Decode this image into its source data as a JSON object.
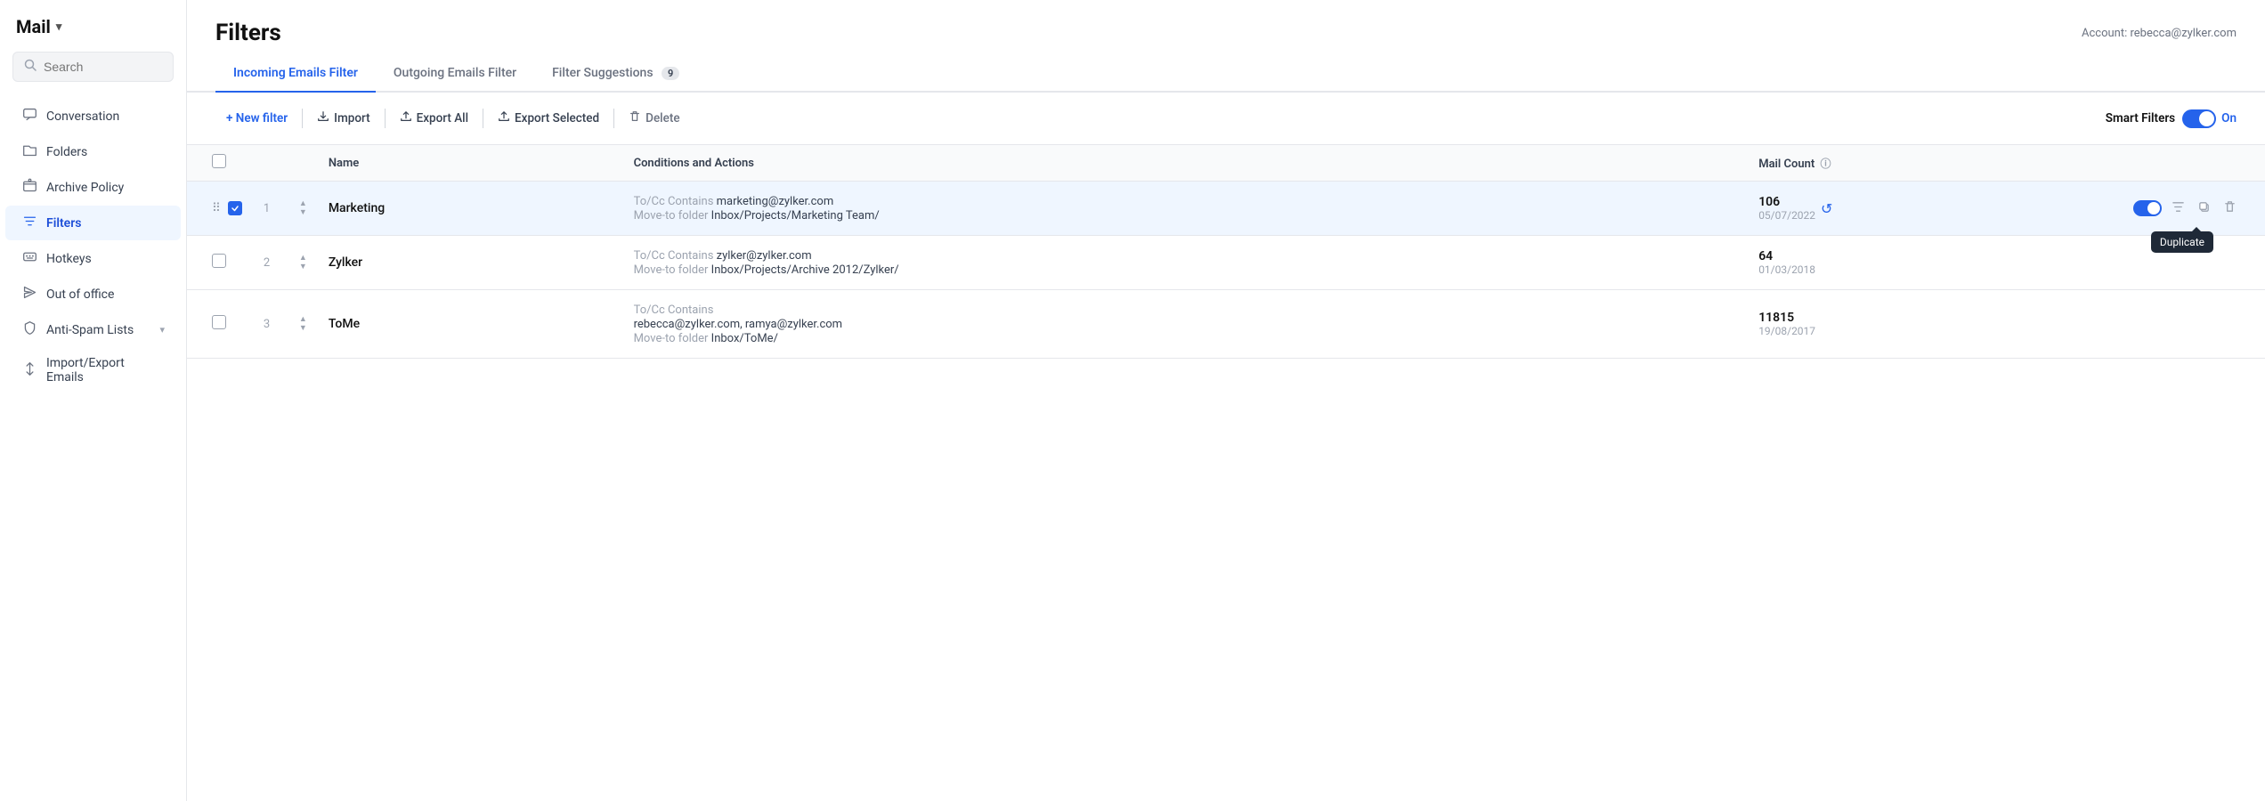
{
  "sidebar": {
    "app_title": "Mail",
    "search_placeholder": "Search",
    "nav_items": [
      {
        "id": "conversation",
        "label": "Conversation",
        "icon": "💬",
        "active": false
      },
      {
        "id": "folders",
        "label": "Folders",
        "icon": "📁",
        "active": false
      },
      {
        "id": "archive-policy",
        "label": "Archive Policy",
        "icon": "🗄",
        "active": false
      },
      {
        "id": "filters",
        "label": "Filters",
        "icon": "⚙",
        "active": true
      },
      {
        "id": "hotkeys",
        "label": "Hotkeys",
        "icon": "⌨",
        "active": false
      },
      {
        "id": "out-of-office",
        "label": "Out of office",
        "icon": "✈",
        "active": false
      },
      {
        "id": "anti-spam",
        "label": "Anti-Spam Lists",
        "icon": "🛡",
        "active": false,
        "has_chevron": true
      },
      {
        "id": "import-export",
        "label": "Import/Export Emails",
        "icon": "↕",
        "active": false
      }
    ]
  },
  "main": {
    "title": "Filters",
    "account_label": "Account: rebecca@zylker.com",
    "tabs": [
      {
        "id": "incoming",
        "label": "Incoming Emails Filter",
        "active": true
      },
      {
        "id": "outgoing",
        "label": "Outgoing Emails Filter",
        "active": false
      },
      {
        "id": "suggestions",
        "label": "Filter Suggestions",
        "active": false,
        "badge": "9"
      }
    ],
    "toolbar": {
      "new_filter": "+ New filter",
      "import": "Import",
      "export_all": "Export All",
      "export_selected": "Export Selected",
      "delete": "Delete",
      "smart_filters": "Smart Filters",
      "smart_filters_state": "On"
    },
    "table": {
      "headers": [
        "",
        "",
        "",
        "Name",
        "Conditions and Actions",
        "Mail Count",
        ""
      ],
      "rows": [
        {
          "num": "1",
          "name": "Marketing",
          "condition_label": "To/Cc Contains",
          "condition_value": "marketing@zylker.com",
          "action_label": "Move-to folder",
          "action_value": "Inbox/Projects/Marketing Team/",
          "mail_count": "106",
          "mail_date": "05/07/2022",
          "selected": true,
          "show_actions": true,
          "show_tooltip": true
        },
        {
          "num": "2",
          "name": "Zylker",
          "condition_label": "To/Cc Contains",
          "condition_value": "zylker@zylker.com",
          "action_label": "Move-to folder",
          "action_value": "Inbox/Projects/Archive 2012/Zylker/",
          "mail_count": "64",
          "mail_date": "01/03/2018",
          "selected": false,
          "show_actions": false,
          "show_tooltip": false
        },
        {
          "num": "3",
          "name": "ToMe",
          "condition_label": "To/Cc Contains",
          "condition_value": "rebecca@zylker.com, ramya@zylker.com",
          "action_label": "Move-to folder",
          "action_value": "Inbox/ToMe/",
          "mail_count": "11815",
          "mail_date": "19/08/2017",
          "selected": false,
          "show_actions": false,
          "show_tooltip": false
        }
      ]
    },
    "tooltip_text": "Duplicate"
  }
}
